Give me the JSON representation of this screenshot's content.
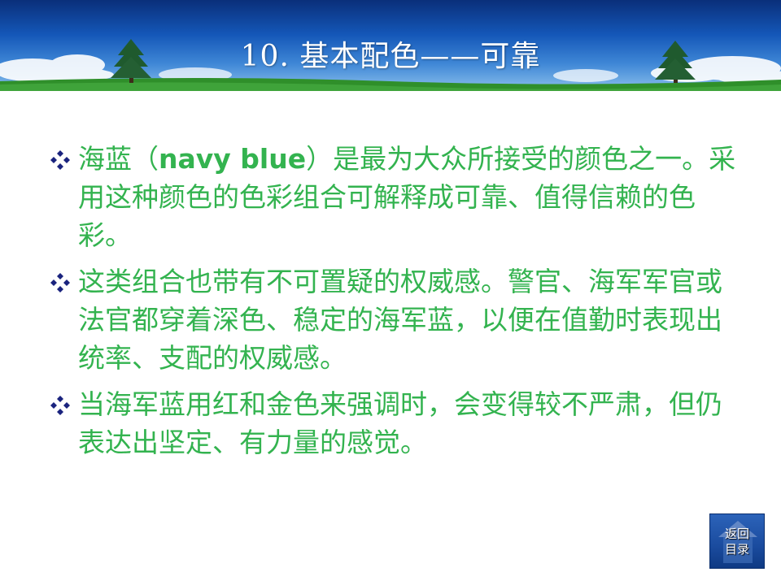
{
  "slide": {
    "title": "10. 基本配色——可靠"
  },
  "bullets": [
    {
      "pre": "海蓝（",
      "latin": "navy blue",
      "post": "）是最为大众所接受的颜色之一。采用这种颜色的色彩组合可解释成可靠、值得信赖的色彩。"
    },
    {
      "pre": "这类组合也带有不可置疑的权威感。警官、海军军官或法官都穿着深色、稳定的海军蓝，以便在值勤时表现出统率、支配的权威感。",
      "latin": "",
      "post": ""
    },
    {
      "pre": "当海军蓝用红和金色来强调时，会变得较不严肃，但仍表达出坚定、有力量的感觉。",
      "latin": "",
      "post": ""
    }
  ],
  "return_button": {
    "line1": "返回",
    "line2": "目录"
  },
  "colors": {
    "text": "#33b34f",
    "bullet": "#1a237e",
    "header_top": "#0a2f7a",
    "header_bottom": "#8cc0ec"
  }
}
